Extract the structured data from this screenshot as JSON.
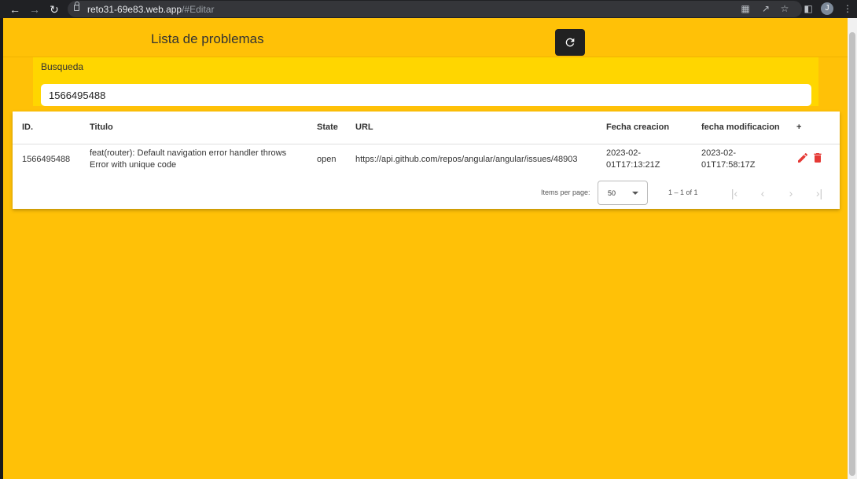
{
  "browser": {
    "url_host": "reto31-69e83.web.app",
    "url_path": "/#Editar",
    "profile_initial": "J"
  },
  "header": {
    "title": "Lista de problemas"
  },
  "search": {
    "label": "Busqueda",
    "value": "1566495488"
  },
  "table": {
    "columns": {
      "id": "ID.",
      "titulo": "Titulo",
      "state": "State",
      "url": "URL",
      "fecha_creacion": "Fecha creacion",
      "fecha_modificacion": "fecha modificacion",
      "add": "+"
    },
    "rows": [
      {
        "id": "1566495488",
        "titulo_line1": "feat(router): Default navigation error handler throws",
        "titulo_line2": "Error with unique code",
        "state": "open",
        "url": "https://api.github.com/repos/angular/angular/issues/48903",
        "creacion_line1": "2023-02-",
        "creacion_line2": "01T17:13:21Z",
        "modificacion_line1": "2023-02-",
        "modificacion_line2": "01T17:58:17Z"
      }
    ]
  },
  "paginator": {
    "items_per_page_label": "Items per page:",
    "items_per_page_value": "50",
    "range_label": "1 – 1 of 1"
  },
  "colors": {
    "background": "#ffc107",
    "search_panel": "#ffd600",
    "action_red": "#e53935",
    "refresh_button": "#212121"
  },
  "icons": {
    "refresh": "refresh-icon",
    "edit": "edit-pencil-icon",
    "delete": "trash-icon"
  }
}
